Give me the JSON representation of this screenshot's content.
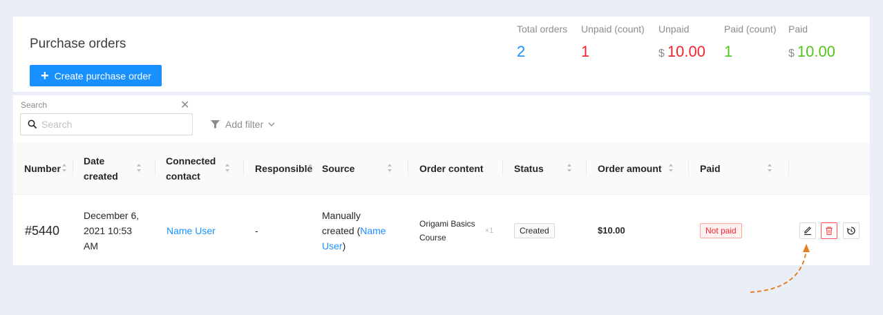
{
  "header": {
    "title": "Purchase orders",
    "create_button": "Create purchase order",
    "stats": [
      {
        "label": "Total orders",
        "currency": "",
        "value": "2",
        "color": "#1890ff"
      },
      {
        "label": "Unpaid (count)",
        "currency": "",
        "value": "1",
        "color": "#f5222d"
      },
      {
        "label": "Unpaid",
        "currency": "$",
        "value": "10.00",
        "color": "#f5222d"
      },
      {
        "label": "Paid (count)",
        "currency": "",
        "value": "1",
        "color": "#52c41a"
      },
      {
        "label": "Paid",
        "currency": "$",
        "value": "10.00",
        "color": "#52c41a"
      }
    ]
  },
  "filters": {
    "search_label": "Search",
    "search_placeholder": "Search",
    "add_filter": "Add filter"
  },
  "table": {
    "columns": [
      "Number",
      "Date created",
      "Connected contact",
      "Responsible",
      "Source",
      "Order content",
      "Status",
      "Order amount",
      "Paid"
    ],
    "rows": [
      {
        "number": "#5440",
        "date_line1": "December 6,",
        "date_line2": "2021 10:53",
        "date_line3": "AM",
        "contact": "Name User",
        "responsible": "-",
        "source_line1": "Manually",
        "source_line2_prefix": "created (",
        "source_link1": "Name",
        "source_link2": "User",
        "source_suffix": ")",
        "content_line1": "Origami Basics",
        "content_line2": "Course",
        "content_qty": "×1",
        "status": "Created",
        "amount": "$10.00",
        "paid": "Not paid"
      }
    ]
  },
  "colors": {
    "accent": "#1890ff",
    "danger": "#f5222d",
    "success": "#52c41a",
    "annotation": "#e67e22"
  },
  "icons": [
    "plus-icon",
    "search-icon",
    "close-icon",
    "filter-icon",
    "chevron-down-icon",
    "sort-icon",
    "edit-icon",
    "delete-icon",
    "history-icon"
  ]
}
